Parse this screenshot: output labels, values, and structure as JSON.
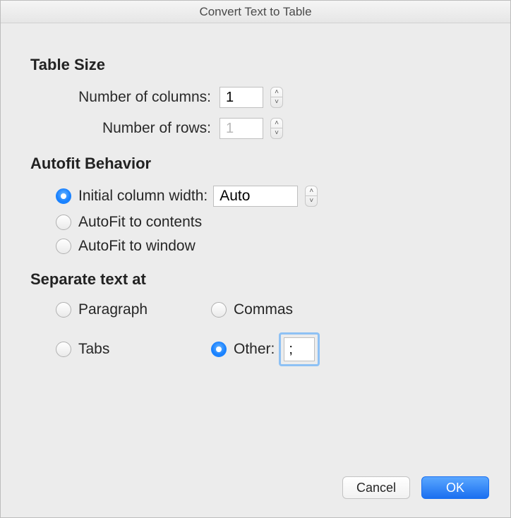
{
  "title": "Convert Text to Table",
  "sections": {
    "table_size": {
      "heading": "Table Size",
      "columns_label": "Number of columns:",
      "columns_value": "1",
      "rows_label": "Number of rows:",
      "rows_value": "1"
    },
    "autofit": {
      "heading": "Autofit Behavior",
      "initial_label": "Initial column width:",
      "initial_value": "Auto",
      "initial_selected": true,
      "contents_label": "AutoFit to contents",
      "contents_selected": false,
      "window_label": "AutoFit to window",
      "window_selected": false
    },
    "separate": {
      "heading": "Separate text at",
      "paragraph_label": "Paragraph",
      "paragraph_selected": false,
      "commas_label": "Commas",
      "commas_selected": false,
      "tabs_label": "Tabs",
      "tabs_selected": false,
      "other_label": "Other:",
      "other_selected": true,
      "other_value": ";"
    }
  },
  "buttons": {
    "cancel": "Cancel",
    "ok": "OK"
  }
}
